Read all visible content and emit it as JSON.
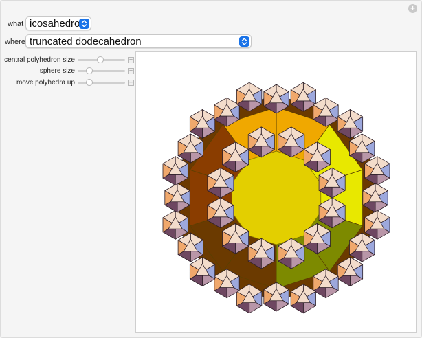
{
  "controls": {
    "what": {
      "label": "what",
      "value": "icosahedron"
    },
    "where": {
      "label": "where",
      "value": "truncated dodecahedron"
    },
    "sliders": [
      {
        "label": "central polyhedron size",
        "value": 0.45
      },
      {
        "label": "sphere size",
        "value": 0.2
      },
      {
        "label": "move polyhedra up",
        "value": 0.2
      }
    ]
  },
  "colors": {
    "accent": "#1a73e8",
    "face_yellow": "#e3cf00",
    "face_orange": "#f0a800",
    "face_lime": "#e8e800",
    "face_brown": "#8a3d00",
    "face_dark_brown": "#6b3a00",
    "face_olive": "#7d8a00",
    "ico_light": "#f3dccb",
    "ico_mauve": "#b996a8",
    "ico_blue": "#9da8dd",
    "ico_orange": "#f0a86c",
    "ico_dark": "#6e4761"
  }
}
